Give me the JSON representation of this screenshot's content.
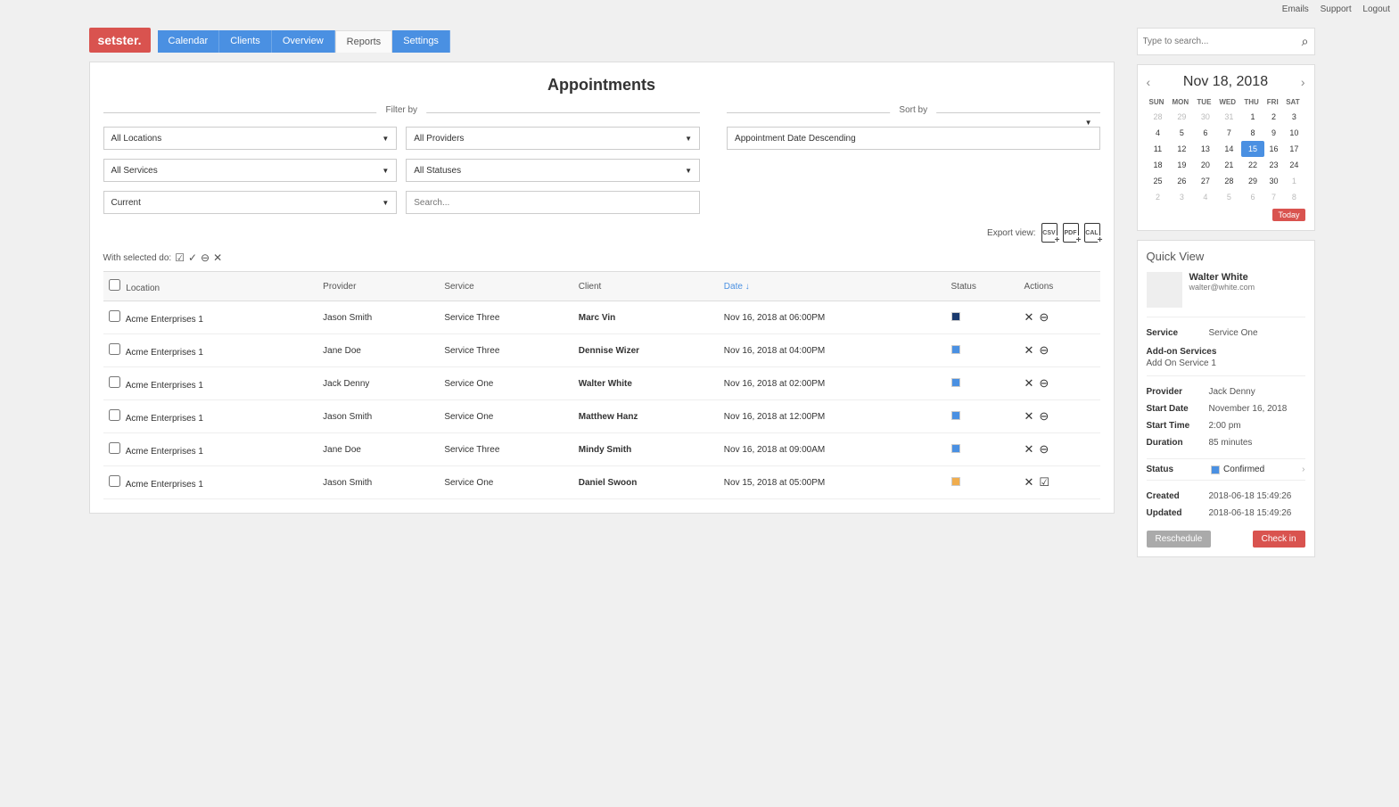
{
  "topLinks": {
    "emails": "Emails",
    "support": "Support",
    "logout": "Logout"
  },
  "logo": "setster.",
  "tabs": [
    "Calendar",
    "Clients",
    "Overview",
    "Reports",
    "Settings"
  ],
  "activeTab": "Reports",
  "pageTitle": "Appointments",
  "filterLabel": "Filter by",
  "sortLabel": "Sort by",
  "filters": {
    "locations": "All Locations",
    "providers": "All Providers",
    "services": "All Services",
    "statuses": "All Statuses",
    "range": "Current",
    "searchPlaceholder": "Search..."
  },
  "sort": {
    "value": "Appointment Date Descending"
  },
  "exportLabel": "Export view:",
  "exportFormats": [
    "CSV",
    "PDF",
    "CAL"
  ],
  "bulkLabel": "With selected do:",
  "columns": [
    "Location",
    "Provider",
    "Service",
    "Client",
    "Date",
    "Status",
    "Actions"
  ],
  "sortedCol": "Date",
  "rows": [
    {
      "location": "Acme Enterprises 1",
      "provider": "Jason Smith",
      "service": "Service Three",
      "client": "Marc Vin",
      "date": "Nov 16, 2018 at 06:00PM",
      "status": "navy",
      "action2": "minus"
    },
    {
      "location": "Acme Enterprises 1",
      "provider": "Jane Doe",
      "service": "Service Three",
      "client": "Dennise Wizer",
      "date": "Nov 16, 2018 at 04:00PM",
      "status": "blue",
      "action2": "minus"
    },
    {
      "location": "Acme Enterprises 1",
      "provider": "Jack Denny",
      "service": "Service One",
      "client": "Walter White",
      "date": "Nov 16, 2018 at 02:00PM",
      "status": "blue",
      "action2": "minus"
    },
    {
      "location": "Acme Enterprises 1",
      "provider": "Jason Smith",
      "service": "Service One",
      "client": "Matthew Hanz",
      "date": "Nov 16, 2018 at 12:00PM",
      "status": "blue",
      "action2": "minus"
    },
    {
      "location": "Acme Enterprises 1",
      "provider": "Jane Doe",
      "service": "Service Three",
      "client": "Mindy Smith",
      "date": "Nov 16, 2018 at 09:00AM",
      "status": "blue",
      "action2": "minus"
    },
    {
      "location": "Acme Enterprises 1",
      "provider": "Jason Smith",
      "service": "Service One",
      "client": "Daniel Swoon",
      "date": "Nov 15, 2018 at 05:00PM",
      "status": "orange",
      "action2": "check"
    }
  ],
  "search": {
    "placeholder": "Type to search..."
  },
  "calendar": {
    "title": "Nov 18, 2018",
    "days": [
      "SUN",
      "MON",
      "TUE",
      "WED",
      "THU",
      "FRI",
      "SAT"
    ],
    "weeks": [
      [
        {
          "d": 28,
          "m": true
        },
        {
          "d": 29,
          "m": true
        },
        {
          "d": 30,
          "m": true
        },
        {
          "d": 31,
          "m": true
        },
        {
          "d": 1
        },
        {
          "d": 2
        },
        {
          "d": 3
        }
      ],
      [
        {
          "d": 4
        },
        {
          "d": 5
        },
        {
          "d": 6
        },
        {
          "d": 7
        },
        {
          "d": 8
        },
        {
          "d": 9
        },
        {
          "d": 10
        }
      ],
      [
        {
          "d": 11
        },
        {
          "d": 12
        },
        {
          "d": 13
        },
        {
          "d": 14
        },
        {
          "d": 15,
          "t": true
        },
        {
          "d": 16
        },
        {
          "d": 17
        }
      ],
      [
        {
          "d": 18
        },
        {
          "d": 19
        },
        {
          "d": 20
        },
        {
          "d": 21
        },
        {
          "d": 22
        },
        {
          "d": 23
        },
        {
          "d": 24
        }
      ],
      [
        {
          "d": 25
        },
        {
          "d": 26
        },
        {
          "d": 27
        },
        {
          "d": 28
        },
        {
          "d": 29
        },
        {
          "d": 30
        },
        {
          "d": 1,
          "m": true
        }
      ],
      [
        {
          "d": 2,
          "m": true
        },
        {
          "d": 3,
          "m": true
        },
        {
          "d": 4,
          "m": true
        },
        {
          "d": 5,
          "m": true
        },
        {
          "d": 6,
          "m": true
        },
        {
          "d": 7,
          "m": true
        },
        {
          "d": 8,
          "m": true
        }
      ]
    ],
    "todayBtn": "Today"
  },
  "quickView": {
    "title": "Quick View",
    "name": "Walter White",
    "email": "walter@white.com",
    "serviceLabel": "Service",
    "service": "Service One",
    "addonLabel": "Add-on Services",
    "addon": "Add On Service 1",
    "providerLabel": "Provider",
    "provider": "Jack Denny",
    "startDateLabel": "Start Date",
    "startDate": "November 16, 2018",
    "startTimeLabel": "Start Time",
    "startTime": "2:00 pm",
    "durationLabel": "Duration",
    "duration": "85 minutes",
    "statusLabel": "Status",
    "status": "Confirmed",
    "createdLabel": "Created",
    "created": "2018-06-18 15:49:26",
    "updatedLabel": "Updated",
    "updated": "2018-06-18 15:49:26",
    "rescheduleBtn": "Reschedule",
    "checkinBtn": "Check in"
  }
}
